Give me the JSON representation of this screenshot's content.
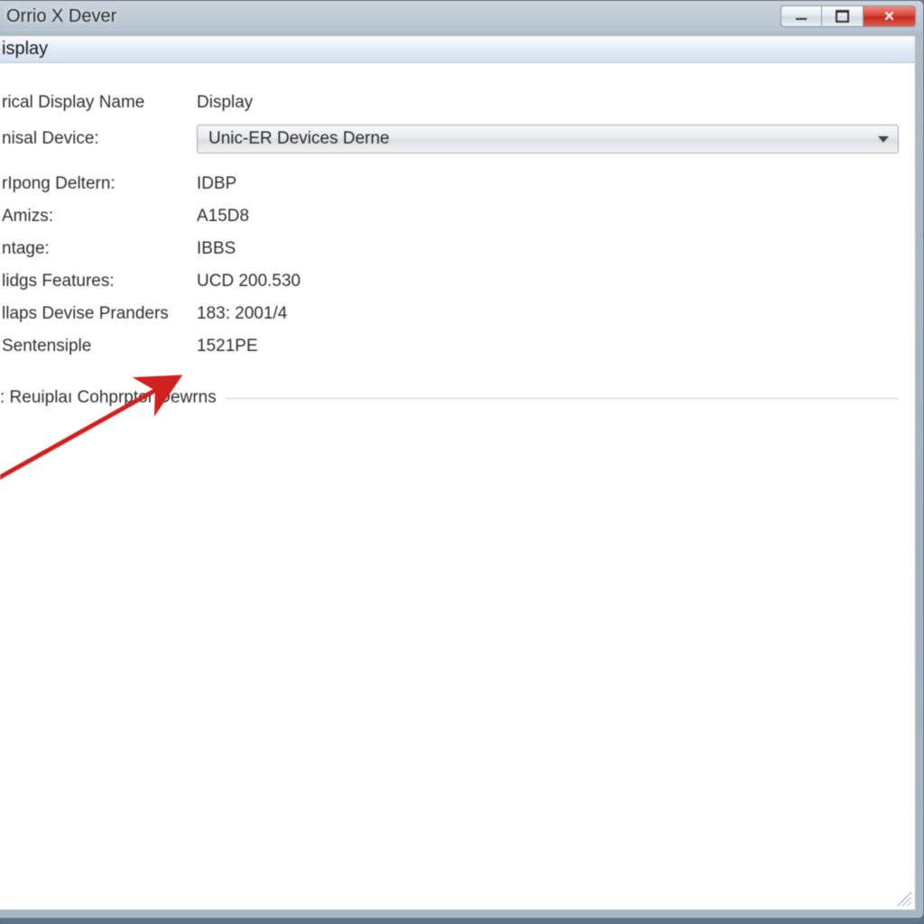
{
  "window": {
    "title": "Orrio X Dever"
  },
  "panel": {
    "header": "isplay"
  },
  "fields": {
    "displayNameLabel": "rical Display Name",
    "displayNameValue": "Display",
    "deviceLabel": "nisal Device:",
    "deviceSelected": "Unic-ER Devices Derne",
    "rows": [
      {
        "label": "rIpong Deltern:",
        "value": "IDBP"
      },
      {
        "label": "Amizs:",
        "value": "A15D8"
      },
      {
        "label": "ntage:",
        "value": "IBBS"
      },
      {
        "label": "lidgs Features:",
        "value": "UCD 200.530"
      },
      {
        "label": "llaps Devise Pranders",
        "value": "183: 2001/4"
      },
      {
        "label": "Sentensiple",
        "value": "1521PE"
      }
    ]
  },
  "section": {
    "title": ": Reuiplaı Cohprptor   Dewrns"
  }
}
